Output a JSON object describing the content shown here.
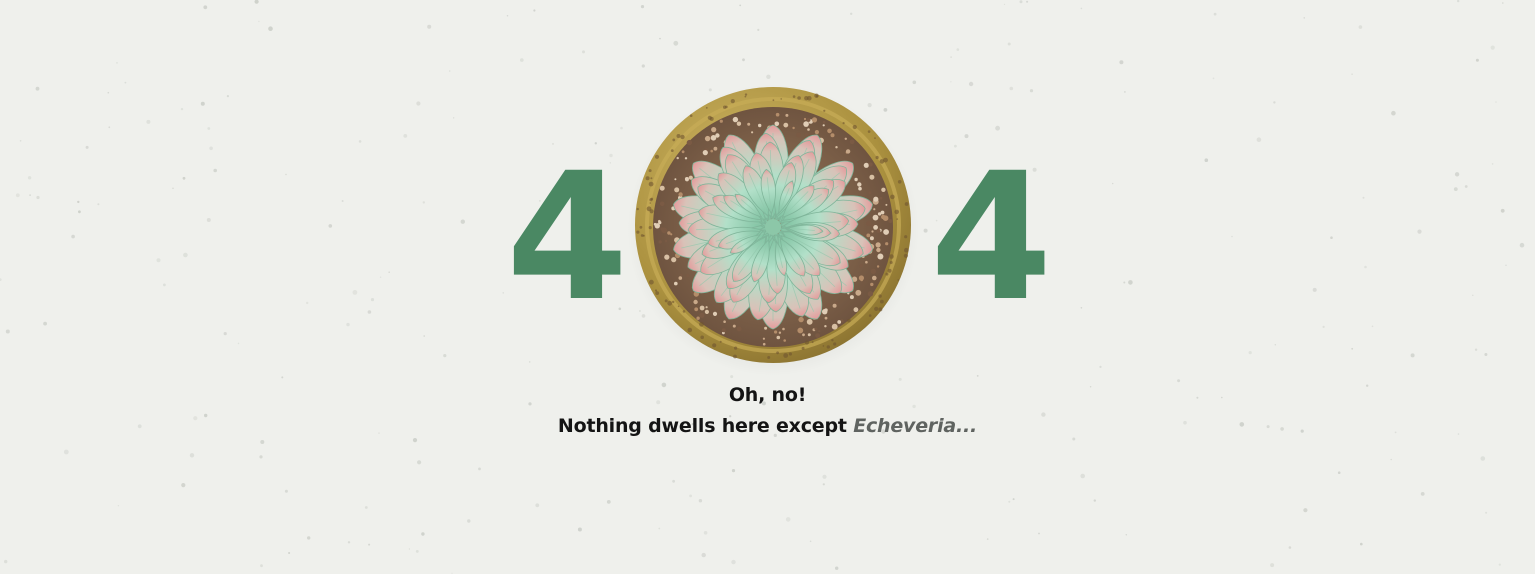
{
  "error": {
    "digit_left": "4",
    "digit_right": "4",
    "headline": "Oh, no!",
    "message": "Nothing dwells here except ",
    "plant_name": "Echeveria..."
  },
  "colors": {
    "background": "#eff0ec",
    "digits": "#4a8863",
    "pot": "#b29a48",
    "soil": "#8c6a4f",
    "leaf": "#a9dcc3",
    "leaf_tip": "#e59a9b",
    "text": "#141414",
    "plant_name_text": "#5f6360"
  },
  "icons": {
    "illustration": "succulent-pot-icon"
  }
}
